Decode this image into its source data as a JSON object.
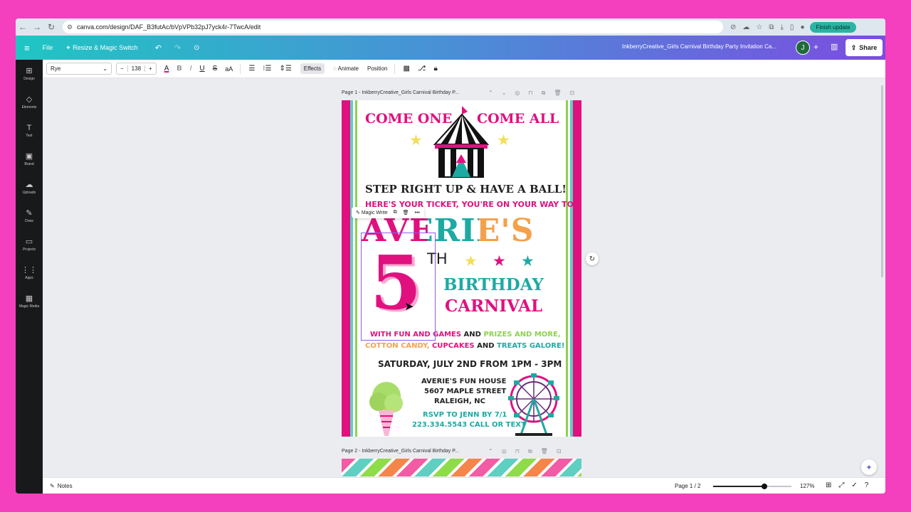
{
  "browser": {
    "url": "canva.com/design/DAF_B3futAc/bVpVPb32pJ7yck4r-7TwcA/edit",
    "finish_update": "Finish update"
  },
  "topbar": {
    "file": "File",
    "resize": "✦ Resize & Magic Switch",
    "doc_title": "InkberryCreative_Girls Carnival Birthday Party Invitation Ca...",
    "avatar": "J",
    "share": "Share"
  },
  "rail": [
    {
      "icon": "⊞",
      "label": "Design"
    },
    {
      "icon": "◇",
      "label": "Elements"
    },
    {
      "icon": "T",
      "label": "Text"
    },
    {
      "icon": "▣",
      "label": "Brand"
    },
    {
      "icon": "☁",
      "label": "Uploads"
    },
    {
      "icon": "✎",
      "label": "Draw"
    },
    {
      "icon": "▭",
      "label": "Projects"
    },
    {
      "icon": "⋮⋮",
      "label": "Apps"
    },
    {
      "icon": "▦",
      "label": "Magic Media"
    }
  ],
  "toolbar": {
    "font": "Rye",
    "size": "138",
    "effects": "Effects",
    "animate": "Animate",
    "position": "Position"
  },
  "canvas": {
    "page1_label": "Page 1 - InkberryCreative_Girls Carnival Birthday P...",
    "page2_label": "Page 2 - InkberryCreative_Girls Carnival Birthday P...",
    "magic_write": "Magic Write"
  },
  "invite": {
    "come_one": "COME ONE",
    "come_all": "COME ALL",
    "step_right": "STEP RIGHT UP & HAVE A BALL!",
    "ticket": "HERE'S YOUR TICKET, YOU'RE ON YOUR WAY TO",
    "name": "AVERIE'S",
    "age": "5",
    "ordinal": "TH",
    "birthday": "BIRTHDAY",
    "carnival": "CARNIVAL",
    "line1_a": "WITH FUN AND GAMES",
    "line1_b": "AND",
    "line1_c": "PRIZES AND MORE,",
    "line2_a": "COTTON CANDY,",
    "line2_b": "CUPCAKES",
    "line2_c": "AND",
    "line2_d": "TREATS GALORE!",
    "date": "SATURDAY, JULY 2ND FROM 1PM - 3PM",
    "venue": "AVERIE'S FUN HOUSE",
    "street": "5607 MAPLE STREET",
    "city": "RALEIGH, NC",
    "rsvp": "RSVP TO JENN BY 7/1",
    "phone": "223.334.5543 CALL OR TEXT"
  },
  "bottombar": {
    "notes": "Notes",
    "pager": "Page 1 / 2",
    "zoom": "127%",
    "zoom_level": 0.65
  },
  "colors": {
    "pink": "#e0117f",
    "teal": "#1eaaa3",
    "green": "#8fd14f",
    "orange": "#f5a04a",
    "yellow": "#f2df5a"
  }
}
